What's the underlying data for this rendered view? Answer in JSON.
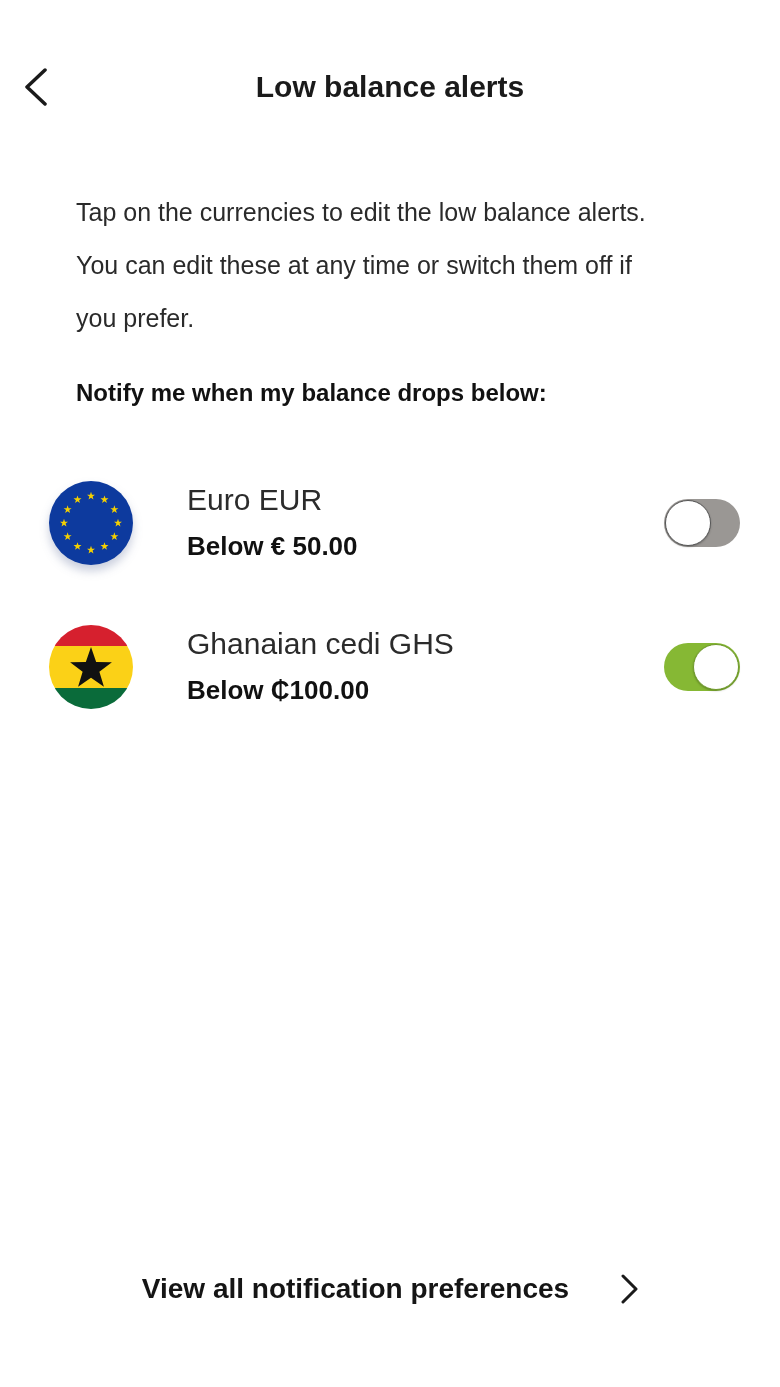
{
  "header": {
    "title": "Low balance alerts"
  },
  "intro": "Tap on the currencies to edit the low balance alerts. You can edit these at any time or switch them off if you prefer.",
  "prompt": "Notify me when my balance drops below:",
  "currencies": [
    {
      "kind": "eu",
      "name": "Euro EUR",
      "threshold": "Below € 50.00",
      "on": false
    },
    {
      "kind": "ghana",
      "name": "Ghanaian cedi GHS",
      "threshold": "Below ₵100.00",
      "on": true
    }
  ],
  "footer_link": {
    "label": "View all notification preferences"
  }
}
